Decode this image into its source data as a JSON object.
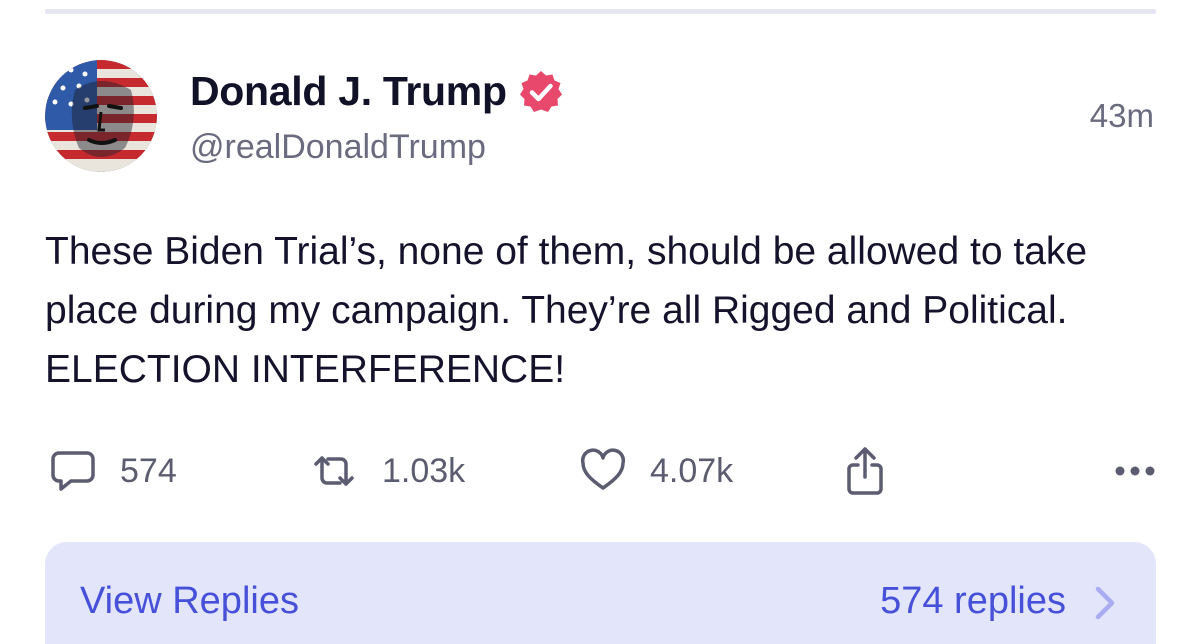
{
  "post": {
    "author": {
      "display_name": "Donald J. Trump",
      "handle": "@realDonaldTrump",
      "verified": true
    },
    "timestamp": "43m",
    "text": "These Biden Trial’s, none of them, should be allowed to take place during my campaign. They’re all Rigged and Political. ELECTION INTERFERENCE!",
    "stats": {
      "replies": "574",
      "reposts": "1.03k",
      "likes": "4.07k"
    }
  },
  "view_replies": {
    "label": "View Replies",
    "count_label": "574 replies"
  },
  "colors": {
    "accent": "#4650d8",
    "verified_badge": "#e8486b",
    "replies_bar_bg": "#e3e5fb",
    "muted_text": "#6b6b80"
  },
  "icons": {
    "replies": "speech-bubble-icon",
    "reposts": "repost-arrows-icon",
    "likes": "heart-icon",
    "share": "share-upload-icon",
    "more": "ellipsis-icon",
    "verified": "verified-badge-icon",
    "chevron": "chevron-right-icon"
  }
}
